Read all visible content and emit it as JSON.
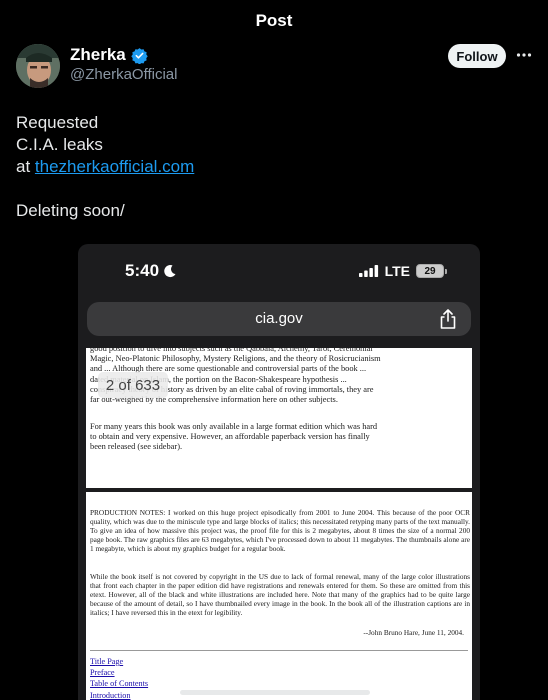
{
  "header": {
    "title": "Post"
  },
  "author": {
    "name": "Zherka",
    "handle": "@ZherkaOfficial",
    "verified": true,
    "follow_label": "Follow",
    "more_icon": "more-horizontal-icon"
  },
  "tweet": {
    "line1": "Requested",
    "line2": "C.I.A. leaks",
    "line3_prefix": "at ",
    "link": "thezherkaofficial.com",
    "line5": "Deleting soon/"
  },
  "embedded_screenshot": {
    "status": {
      "time": "5:40",
      "network": "LTE",
      "battery": "29"
    },
    "url": "cia.gov",
    "page_counter": "2 of 633",
    "page_a": {
      "para1": "good position to dive into subjects such as the Qabbala, Alchemy, Tarot, Ceremonial Magic, Neo-Platonic Philosophy, Mystery Religions, and the theory of Rosicrucianism and ... Although there are some questionable and controversial parts of the book ... dated material on Islam, the portion on the Bacon-Shakespeare hypothesis ... conspiracy theory of history as driven by an elite cabal of roving immortals, they are far out-weighed by the comprehensive information here on other subjects.",
      "para2": "For many years this book was only available in a large format edition which was hard to obtain and very expensive. However, an affordable paperback version has finally been released (see sidebar)."
    },
    "page_b": {
      "notes1": "PRODUCTION NOTES: I worked on this huge project episodically from 2001 to June 2004. This because of the poor OCR quality, which was due to the miniscule type and large blocks of italics; this necessitated retyping many parts of the text manually. To give an idea of how massive this project was, the proof file for this is 2 megabytes, about 8 times the size of a normal 200 page book. The raw graphics files are 63 megabytes, which I've processed down to about 11 megabytes. The thumbnails alone are 1 megabyte, which is about my graphics budget for a regular book.",
      "notes2": "While the book itself is not covered by copyright in the US due to lack of formal renewal, many of the large color illustrations that front each chapter in the paper edition did have registrations and renewals entered for them. So these are omitted from this etext. However, all of the black and white illustrations are included here. Note that many of the graphics had to be quite large because of the amount of detail, so I have thumbnailed every image in the book. In the book all of the illustration captions are in italics; I have reversed this in the etext for legibility.",
      "signature": "--John Bruno Hare, June 11, 2004.",
      "toc": [
        "Title Page",
        "Preface",
        "Table of Contents",
        "Introduction"
      ]
    }
  },
  "colors": {
    "background": "#000000",
    "link": "#1d9bf0",
    "verified_badge": "#1d9bf0",
    "follow_button_bg": "#eff3f4"
  }
}
